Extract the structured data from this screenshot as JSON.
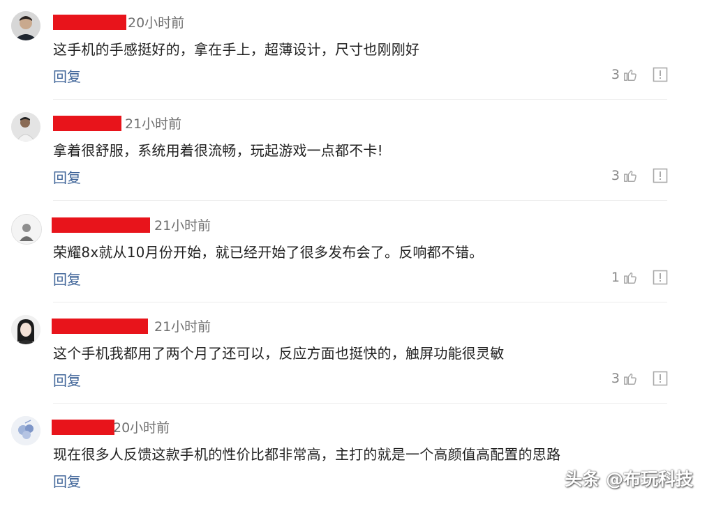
{
  "comments": [
    {
      "time": "20小时前",
      "text": "这手机的手感挺好的，拿在手上，超薄设计，尺寸也刚刚好",
      "reply": "回复",
      "likes": "3"
    },
    {
      "time": "21小时前",
      "text": "拿着很舒服，系统用着很流畅，玩起游戏一点都不卡!",
      "reply": "回复",
      "likes": "3"
    },
    {
      "time": "21小时前",
      "text": "荣耀8x就从10月份开始，就已经开始了很多发布会了。反响都不错。",
      "reply": "回复",
      "likes": "1"
    },
    {
      "time": "21小时前",
      "text": "这个手机我都用了两个月了还可以，反应方面也挺快的，触屏功能很灵敏",
      "reply": "回复",
      "likes": "3"
    },
    {
      "time": "20小时前",
      "text": "现在很多人反馈这款手机的性价比都非常高，主打的就是一个高颜值高配置的思路",
      "reply": "回复",
      "likes": ""
    }
  ],
  "watermark": "头条 @布玩科技",
  "colors": {
    "redaction": "#e8141b",
    "reply_link": "#406599",
    "meta": "#707070"
  },
  "icons": {
    "like": "thumbs-up-icon",
    "report": "report-icon"
  }
}
